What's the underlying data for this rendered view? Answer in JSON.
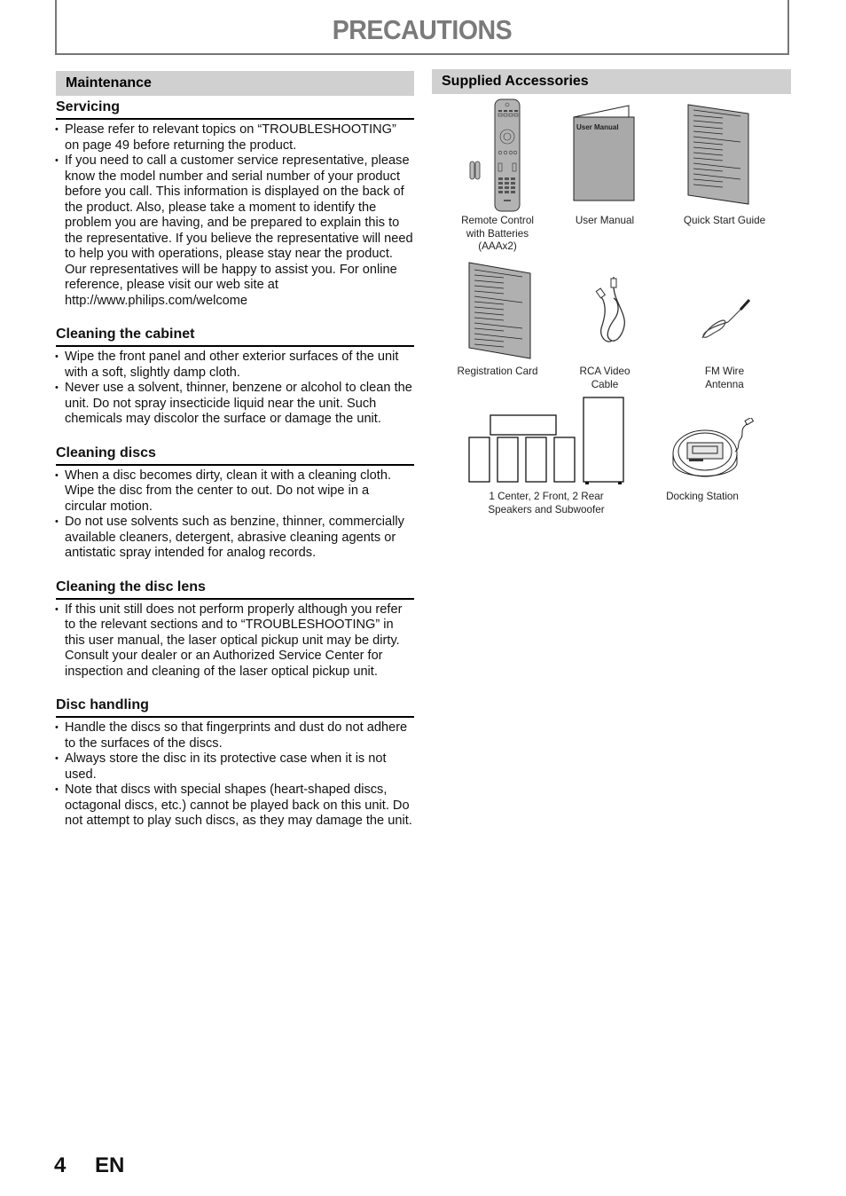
{
  "header": {
    "title": "PRECAUTIONS"
  },
  "maintenance": {
    "band_label": "Maintenance",
    "sections": [
      {
        "heading": "Servicing",
        "bullets": [
          "Please refer to relevant topics on “TROUBLESHOOTING” on page 49 before returning the product.",
          "If you need to call a customer service representative, please know the model number and serial number of your product before you call. This information is displayed on the back of the product. Also, please take a moment to identify the problem you are having, and be prepared to explain this to the representative. If you believe the representative will need to help you with operations, please stay near the product. Our representatives will be happy to assist you. For online reference, please visit our web site at http://www.philips.com/welcome"
        ]
      },
      {
        "heading": "Cleaning the cabinet",
        "bullets": [
          "Wipe the front panel and other exterior surfaces of the unit with a soft, slightly damp cloth.",
          "Never use a solvent, thinner, benzene or alcohol to clean the unit. Do not spray insecticide liquid near the unit. Such chemicals may discolor the surface or damage the unit."
        ]
      },
      {
        "heading": "Cleaning discs",
        "bullets": [
          "When a disc becomes dirty, clean it with a cleaning cloth. Wipe the disc from the center to out. Do not wipe in a circular motion.",
          "Do not use solvents such as benzine, thinner, commercially available cleaners, detergent, abrasive cleaning agents or antistatic spray intended for analog records."
        ]
      },
      {
        "heading": "Cleaning the disc lens",
        "bullets": [
          "If this unit still does not perform properly although you refer to the relevant sections and to “TROUBLESHOOTING” in this user manual, the laser optical pickup unit may be dirty. Consult your dealer or an Authorized Service Center for inspection and cleaning of the laser optical pickup unit."
        ]
      },
      {
        "heading": "Disc handling",
        "bullets": [
          "Handle the discs so that fingerprints and dust do not adhere to the surfaces of the discs.",
          "Always store the disc in its protective case when it is not used.",
          "Note that discs with special shapes (heart-shaped discs, octagonal discs, etc.) cannot be played back on this unit. Do not attempt to play such discs, as they may damage the unit."
        ]
      }
    ]
  },
  "accessories": {
    "band_label": "Supplied Accessories",
    "items": [
      {
        "icon": "remote-control-icon",
        "label_lines": [
          "Remote Control",
          "with Batteries",
          "(AAAx2)"
        ]
      },
      {
        "icon": "user-manual-icon",
        "label_lines": [
          "User Manual"
        ],
        "cover_text": "User Manual"
      },
      {
        "icon": "quick-start-guide-icon",
        "label_lines": [
          "Quick Start Guide"
        ]
      },
      {
        "icon": "registration-card-icon",
        "label_lines": [
          "Registration Card"
        ]
      },
      {
        "icon": "rca-video-cable-icon",
        "label_lines": [
          "RCA Video",
          "Cable"
        ]
      },
      {
        "icon": "fm-wire-antenna-icon",
        "label_lines": [
          "FM Wire",
          "Antenna"
        ]
      },
      {
        "icon": "speakers-subwoofer-icon",
        "label_lines": [
          "1 Center, 2 Front, 2 Rear",
          "Speakers and Subwoofer"
        ]
      },
      {
        "icon": "docking-station-icon",
        "label_lines": [
          "Docking Station"
        ]
      }
    ]
  },
  "footer": {
    "page_number": "4",
    "language": "EN"
  }
}
